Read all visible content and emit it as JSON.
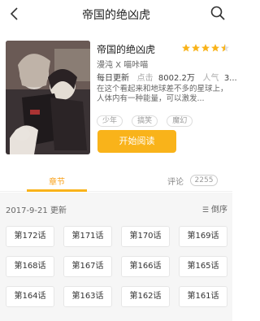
{
  "header": {
    "title": "帝国的绝凶虎"
  },
  "book": {
    "name": "帝国的绝凶虎",
    "rating_stars": 4.5,
    "author": "漫沌 X 喵咔喵",
    "update_freq": "每日更新",
    "clicks_label": "点击",
    "clicks_value": "8002.2万",
    "popularity_label": "人气",
    "popularity_value": "3...",
    "description": "在这个看起来和地球差不多的星球上，人体内有一种能量，可以激发...",
    "tags": [
      "少年",
      "搞笑",
      "魔幻"
    ],
    "read_button": "开始阅读"
  },
  "tabs": {
    "chapters": "章节",
    "comments": "评论",
    "comment_count": "2255"
  },
  "list": {
    "update_date": "2017-9-21 更新",
    "sort_label": "倒序",
    "chapters": [
      "第172话",
      "第171话",
      "第170话",
      "第169话",
      "第168话",
      "第167话",
      "第166话",
      "第165话",
      "第164话",
      "第163话",
      "第162话",
      "第161话"
    ]
  },
  "colors": {
    "accent": "#f9b31a",
    "star": "#f9b31a",
    "list_bg": "#f6f6f6"
  }
}
